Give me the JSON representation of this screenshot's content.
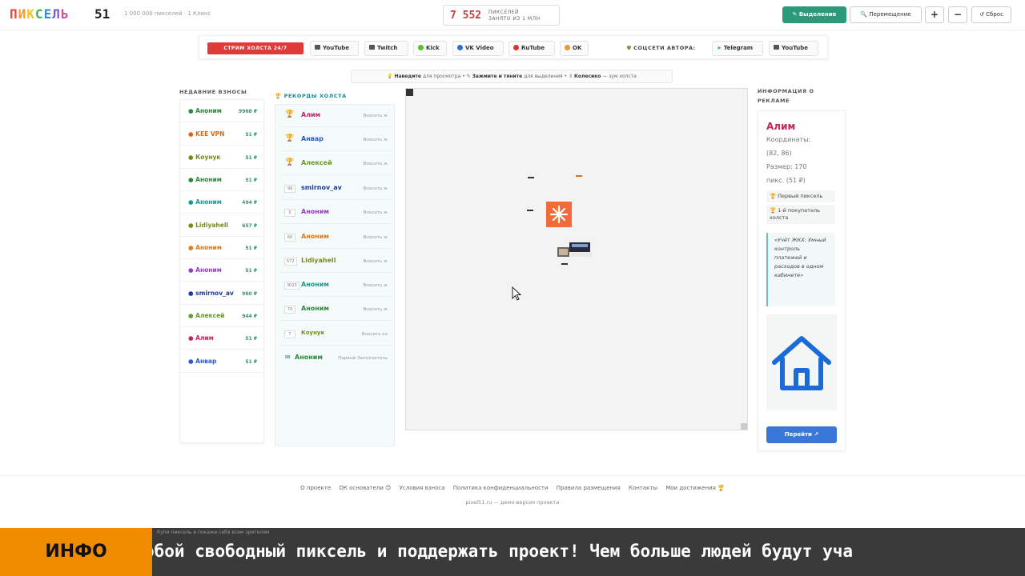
{
  "header": {
    "logo_letters": [
      "П",
      "И",
      "К",
      "С",
      "Е",
      "Л",
      "Ь"
    ],
    "logo_colors": [
      "#e8473a",
      "#f0962e",
      "#e9c62a",
      "#3fb34f",
      "#2f8fd8",
      "#7b5bd6",
      "#d64ea0"
    ],
    "logo_number": "51",
    "subtitle": "1 000 000 пикселей · 1 Клинс",
    "counter_value": "7 552",
    "counter_line1": "ПИКСЕЛЕЙ",
    "counter_line2": "ЗАНЯТО ИЗ 1 МЛН",
    "select_btn": "✎ Выделение",
    "move_btn": "🔍 Перемещение",
    "zoom_in": "+",
    "zoom_out": "−",
    "reset_btn": "↺ Сброс"
  },
  "streambar": {
    "live": "СТРИМ ХОЛСТА 24/7",
    "platforms": [
      {
        "label": "YouTube",
        "icon": "youtube-icon",
        "color": "#555555"
      },
      {
        "label": "Twitch",
        "icon": "twitch-icon",
        "color": "#555555"
      },
      {
        "label": "Kick",
        "icon": "kick-icon",
        "color": "#53c12a"
      },
      {
        "label": "VK Video",
        "icon": "vk-icon",
        "color": "#2a73d0"
      },
      {
        "label": "RuTube",
        "icon": "rutube-icon",
        "color": "#e0332f"
      },
      {
        "label": "OK",
        "icon": "ok-icon",
        "color": "#f0962e"
      }
    ],
    "authors_label": "СОЦСЕТИ АВТОРА:",
    "author_links": [
      {
        "label": "Telegram",
        "icon": "telegram-icon"
      },
      {
        "label": "YouTube",
        "icon": "youtube-icon"
      }
    ]
  },
  "hint": {
    "a_bold": "Наведите",
    "a_rest": "для просмотра",
    "b_bold": "Зажмите и тяните",
    "b_rest": "для выделения",
    "c_bold": "Колесико",
    "c_rest": "зум холста"
  },
  "recent": {
    "title": "НЕДАВНИЕ ВЗНОСЫ",
    "items": [
      {
        "name": "Аноним",
        "amount": "9968 ₽",
        "color": "#2a8a3a"
      },
      {
        "name": "KEE VPN",
        "amount": "51 ₽",
        "color": "#d36a1a"
      },
      {
        "name": "Коунук",
        "amount": "51 ₽",
        "color": "#7a8a1a"
      },
      {
        "name": "Аноним",
        "amount": "51 ₽",
        "color": "#2a8a3a"
      },
      {
        "name": "Аноним",
        "amount": "494 ₽",
        "color": "#1a9a8a"
      },
      {
        "name": "Lidiyahell",
        "amount": "657 ₽",
        "color": "#7a8a1a"
      },
      {
        "name": "Аноним",
        "amount": "51 ₽",
        "color": "#e07a1a"
      },
      {
        "name": "Аноним",
        "amount": "51 ₽",
        "color": "#9a3ad0"
      },
      {
        "name": "smirnov_av",
        "amount": "960 ₽",
        "color": "#1a3a9a"
      },
      {
        "name": "Алексей",
        "amount": "944 ₽",
        "color": "#6a9a2a"
      },
      {
        "name": "Алим",
        "amount": "51 ₽",
        "color": "#c7245d"
      },
      {
        "name": "Анвар",
        "amount": "51 ₽",
        "color": "#2a5ad0"
      }
    ]
  },
  "records": {
    "title": "РЕКОРДЫ ХОЛСТА",
    "items": [
      {
        "badge": "🏆",
        "name": "Алим",
        "desc": "Вносить ж",
        "color": "#c7245d"
      },
      {
        "badge": "🏆",
        "name": "Анвар",
        "desc": "Вносить ж",
        "color": "#2a5ad0"
      },
      {
        "badge": "🏆",
        "name": "Алексей",
        "desc": "Вносить ж",
        "color": "#6a9a2a"
      },
      {
        "badge": "99",
        "name": "smirnov_av",
        "desc": "Вносить ж",
        "color": "#1a3a9a"
      },
      {
        "badge": "5",
        "name": "Аноним",
        "desc": "Вносить ж",
        "color": "#9a3ad0"
      },
      {
        "badge": "60",
        "name": "Аноним",
        "desc": "Вносить ж",
        "color": "#e07a1a"
      },
      {
        "badge": "572",
        "name": "Lidiyahell",
        "desc": "Вносить ж",
        "color": "#7a8a1a"
      },
      {
        "badge": "3023",
        "name": "Аноним",
        "desc": "Вносить ж",
        "color": "#1a9a8a"
      },
      {
        "badge": "70",
        "name": "Аноним",
        "desc": "Вносить ж",
        "color": "#2a8a3a"
      },
      {
        "badge": "7",
        "name": "Коунук",
        "desc": "Вносить ко",
        "color": "#7a8a1a"
      },
      {
        "badge": "✉",
        "name": "Аноним",
        "desc": "Первый Заполнитель",
        "color": "#2a8a3a"
      }
    ]
  },
  "ad": {
    "title": "ИНФОРМАЦИЯ О РЕКЛАМЕ",
    "name": "Алим",
    "coords_label": "Координаты:",
    "coords_value": "(82, 86)",
    "size_label": "Размер: 170",
    "size_value": "пикс. (51 ₽)",
    "tag1": "🏆 Первый пиксель",
    "tag2_l1": "🏆 1-й покупатель",
    "tag2_l2": "холста",
    "quote": "«Учёт ЖКХ: Умный контроль платежей и расходов в одном кабинете»",
    "image_icon": "house-icon",
    "go_btn": "Перейти ↗"
  },
  "footer": {
    "links": [
      "О проекте",
      "ОК основатели 😊",
      "Условия взноса",
      "Политика конфиденциальности",
      "Правила размещения",
      "Контакты",
      "Мои достижения 🏆"
    ],
    "sub": "pixel51.ru — демо-версия проекта"
  },
  "ticker": {
    "label": "ИНФО",
    "faint": "Купи пиксель и покажи себя всем зрителям",
    "text": "обой свободный пиксель и поддержать проект! Чем больше людей будут уча"
  }
}
